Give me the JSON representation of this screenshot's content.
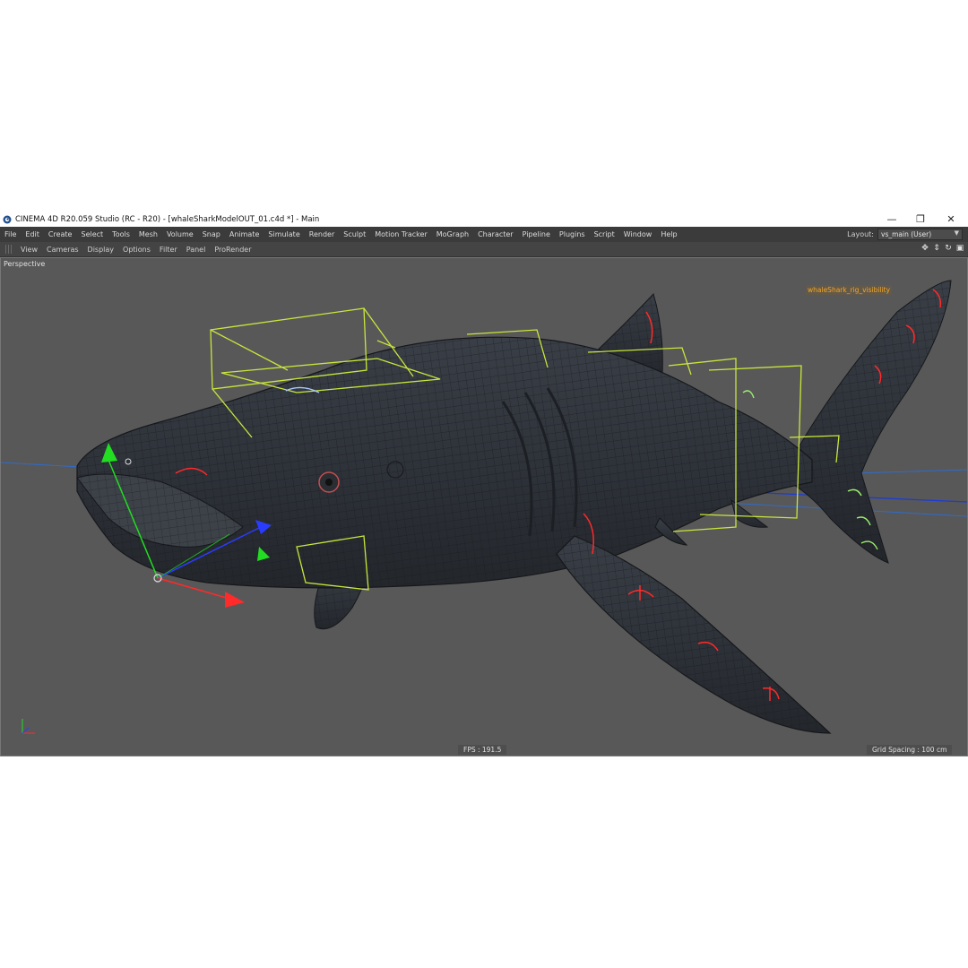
{
  "window": {
    "title": "CINEMA 4D R20.059 Studio (RC - R20) - [whaleSharkModelOUT_01.c4d *] - Main",
    "minimize_glyph": "—",
    "restore_glyph": "❐",
    "close_glyph": "✕"
  },
  "menubar": {
    "items": [
      "File",
      "Edit",
      "Create",
      "Select",
      "Tools",
      "Mesh",
      "Volume",
      "Snap",
      "Animate",
      "Simulate",
      "Render",
      "Sculpt",
      "Motion Tracker",
      "MoGraph",
      "Character",
      "Pipeline",
      "Plugins",
      "Script",
      "Window",
      "Help"
    ],
    "layout_label": "Layout:",
    "layout_value": "vs_main (User)"
  },
  "view_menu": {
    "items": [
      "View",
      "Cameras",
      "Display",
      "Options",
      "Filter",
      "Panel",
      "ProRender"
    ],
    "nav_icons": [
      "move-view-icon",
      "dolly-view-icon",
      "rotate-view-icon",
      "maximize-view-icon"
    ]
  },
  "viewport": {
    "camera": "Perspective",
    "object_label": "whaleShark_rig_visibility",
    "fps": "FPS : 191.5",
    "grid_spacing": "Grid Spacing : 100 cm"
  },
  "colors": {
    "app_bg": "#5b5b5b",
    "menubar_bg": "#3b3b3b",
    "viewport_bg": "#585858",
    "mesh": "#2e3238",
    "wire": "#1a1c20",
    "rig_green": "#c8e63c",
    "axis_x": "#ff2a2a",
    "axis_y": "#22dd22",
    "axis_z": "#2a3cff",
    "label_orange": "#f5a623"
  }
}
